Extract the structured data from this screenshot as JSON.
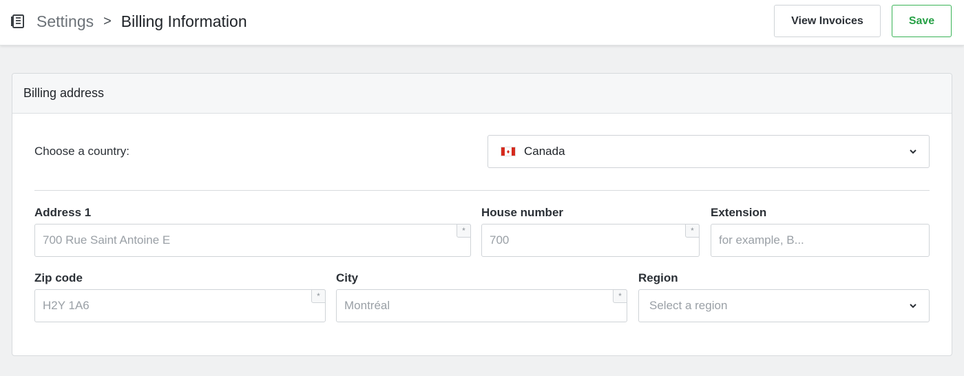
{
  "header": {
    "icon": "book-icon",
    "breadcrumb_parent": "Settings",
    "breadcrumb_separator": ">",
    "breadcrumb_current": "Billing Information",
    "view_invoices_label": "View Invoices",
    "save_label": "Save",
    "save_color": "#27a046"
  },
  "billing": {
    "title": "Billing address",
    "country_label": "Choose a country:",
    "country_value": "Canada",
    "country_flag": "canada-flag-icon",
    "required_marker": "*",
    "fields": {
      "address1": {
        "label": "Address 1",
        "placeholder": "700 Rue Saint Antoine E"
      },
      "house_number": {
        "label": "House number",
        "placeholder": "700"
      },
      "extension": {
        "label": "Extension",
        "placeholder": "for example, B..."
      },
      "zip": {
        "label": "Zip code",
        "placeholder": "H2Y 1A6"
      },
      "city": {
        "label": "City",
        "placeholder": "Montréal"
      },
      "region": {
        "label": "Region",
        "placeholder": "Select a region"
      }
    }
  }
}
